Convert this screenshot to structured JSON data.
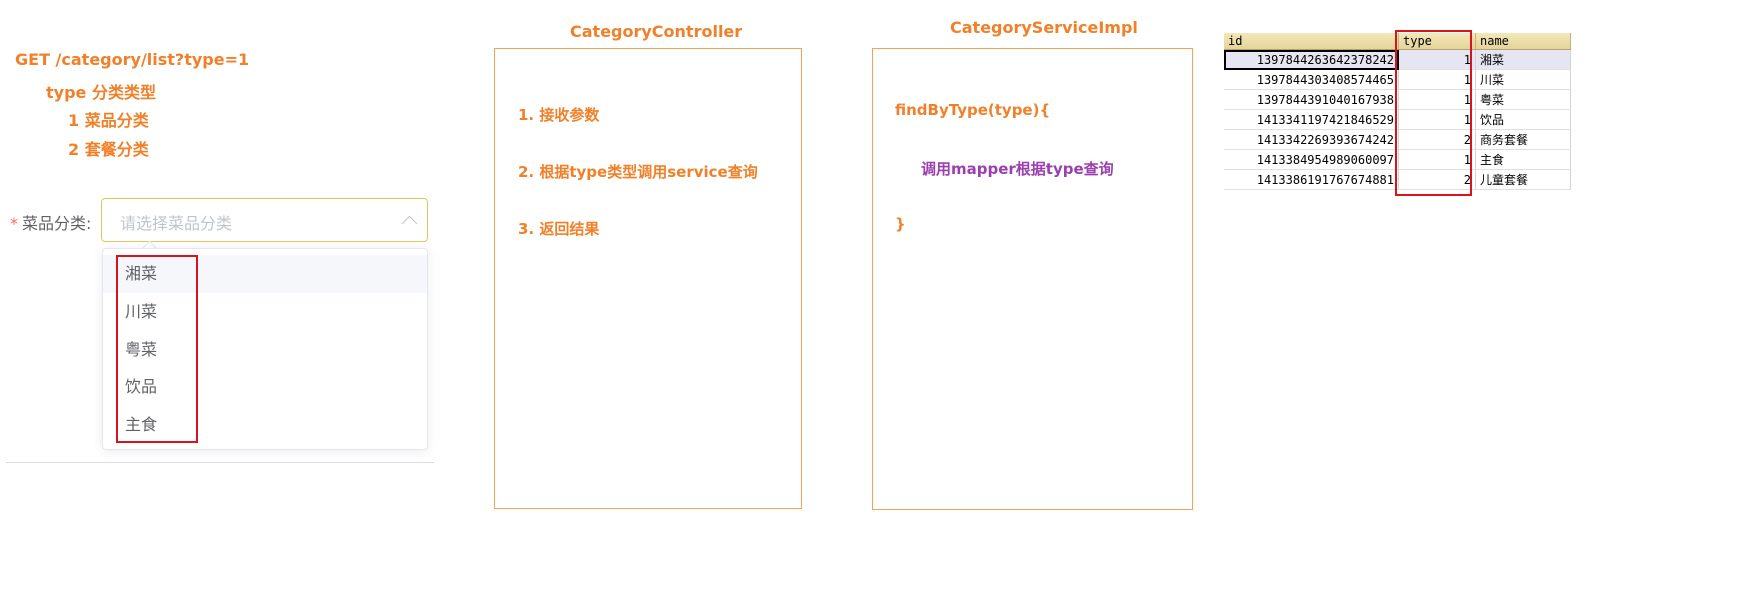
{
  "api": {
    "request": "GET /category/list?type=1",
    "param": "type 分类类型",
    "option_1": "1  菜品分类",
    "option_2": "2  套餐分类"
  },
  "form": {
    "required_mark": "*",
    "label": "菜品分类:",
    "placeholder": "请选择菜品分类",
    "options": [
      "湘菜",
      "川菜",
      "粤菜",
      "饮品",
      "主食"
    ]
  },
  "controller": {
    "title": "CategoryController",
    "steps": [
      "1. 接收参数",
      "2. 根据type类型调用service查询",
      "3. 返回结果"
    ]
  },
  "service": {
    "title": "CategoryServiceImpl",
    "method_open": "findByType(type){",
    "body": "调用mapper根据type查询",
    "method_close": "}"
  },
  "table": {
    "headers": [
      "id",
      "type",
      "name"
    ],
    "rows": [
      [
        "1397844263642378242",
        "1",
        "湘菜"
      ],
      [
        "1397844303408574465",
        "1",
        "川菜"
      ],
      [
        "1397844391040167938",
        "1",
        "粤菜"
      ],
      [
        "1413341197421846529",
        "1",
        "饮品"
      ],
      [
        "1413342269393674242",
        "2",
        "商务套餐"
      ],
      [
        "1413384954989060097",
        "1",
        "主食"
      ],
      [
        "1413386191767674881",
        "2",
        "儿童套餐"
      ]
    ]
  },
  "colors": {
    "accent_orange": "#f0802a",
    "accent_purple": "#9b3fb0",
    "highlight_red": "#d7141d"
  }
}
